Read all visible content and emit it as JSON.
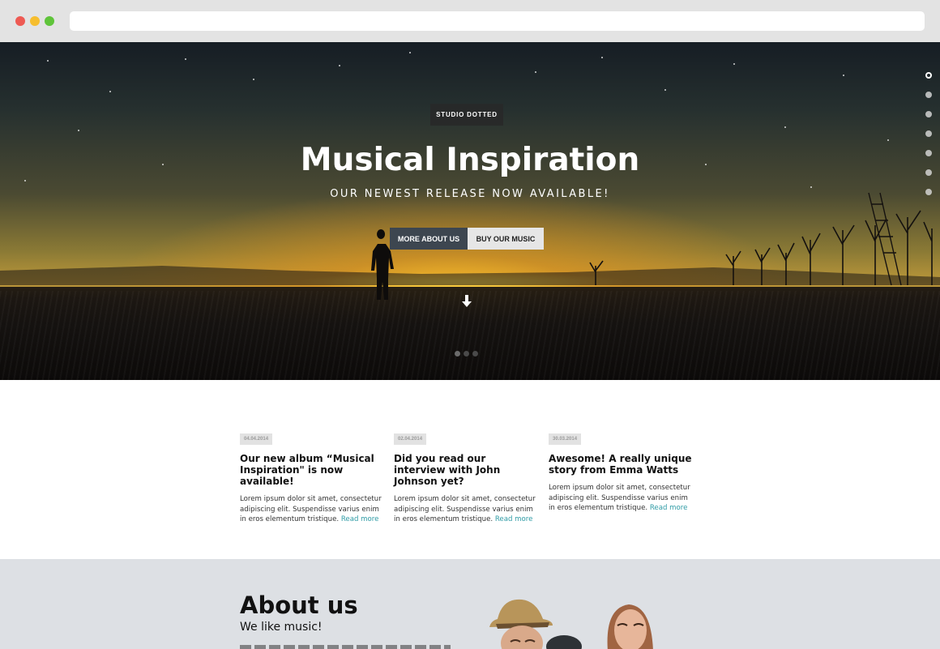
{
  "browser": {
    "url": ""
  },
  "hero": {
    "badge": "STUDIO DOTTED",
    "title": "Musical Inspiration",
    "subtitle": "OUR NEWEST RELEASE NOW AVAILABLE!",
    "primary_button": "MORE ABOUT US",
    "secondary_button": "BUY OUR MUSIC",
    "slider_count": 3,
    "slider_active": 1,
    "side_nav_count": 7,
    "side_nav_active": 1
  },
  "news": [
    {
      "date": "04.04.2014",
      "title": "Our new album “Musical Inspiration\" is now available!",
      "body": "Lorem ipsum dolor sit amet, consectetur adipiscing elit. Suspendisse varius enim in eros elementum tristique.",
      "link": "Read more"
    },
    {
      "date": "02.04.2014",
      "title": "Did you read our interview with John Johnson yet?",
      "body": "Lorem ipsum dolor sit amet, consectetur adipiscing elit. Suspendisse varius enim in eros elementum tristique.",
      "link": "Read more"
    },
    {
      "date": "30.03.2014",
      "title": "Awesome! A really unique story from Emma Watts",
      "body": "Lorem ipsum dolor sit amet, consectetur adipiscing elit. Suspendisse varius enim in eros elementum tristique.",
      "link": "Read more"
    }
  ],
  "about": {
    "title": "About us",
    "subtitle": "We like music!"
  }
}
